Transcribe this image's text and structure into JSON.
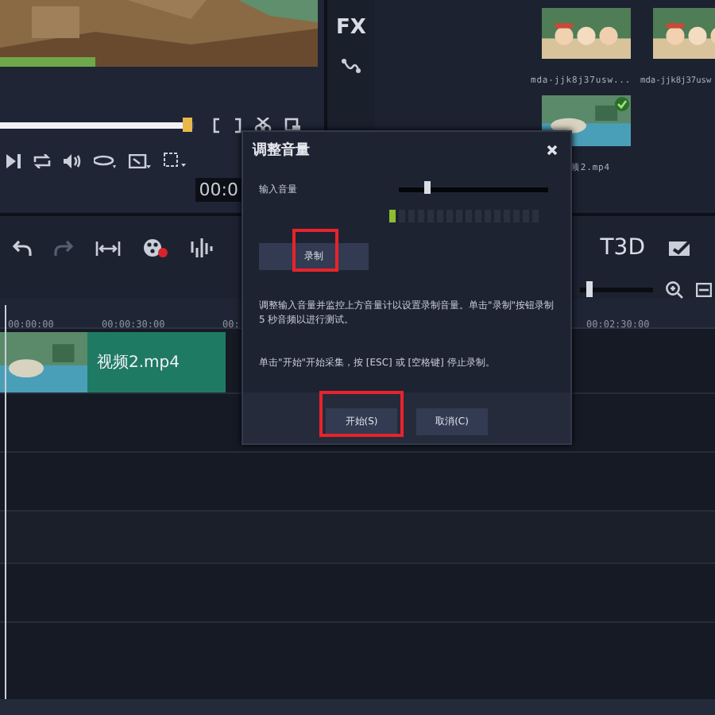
{
  "preview": {
    "scrubber": {
      "level": 0.97
    },
    "timecode": "00:0"
  },
  "side_panel": {
    "fx_label": "FX"
  },
  "library": {
    "items": [
      {
        "label": "mda-jjk8j37usw...",
        "checked": false
      },
      {
        "label": "mda-jjk8j37usw",
        "checked": false
      },
      {
        "label": "频2.mp4",
        "checked": true
      }
    ]
  },
  "toolbar": {
    "title_3d": "T3D",
    "zoom": {
      "level": 0.1
    }
  },
  "ruler": {
    "ticks": [
      "00:00:00",
      "00:00:30:00",
      "00:",
      "00:02:30:00"
    ]
  },
  "timeline": {
    "clip": {
      "label": "视频2.mp4"
    }
  },
  "dialog": {
    "title": "调整音量",
    "input_label": "输入音量",
    "input_volume": {
      "level": 0.18
    },
    "meter": {
      "level": 0.07
    },
    "record_button": {
      "label": "录制",
      "highlighted": true
    },
    "instructions": [
      "调整输入音量并监控上方音量计以设置录制音量。单击\"录制\"按钮录制 5 秒音频以进行测试。",
      "单击\"开始\"开始采集，按 [ESC] 或 [空格键] 停止录制。"
    ],
    "buttons": [
      {
        "label": "开始(S)",
        "highlighted": true
      },
      {
        "label": "取消(C)",
        "highlighted": false
      }
    ]
  }
}
